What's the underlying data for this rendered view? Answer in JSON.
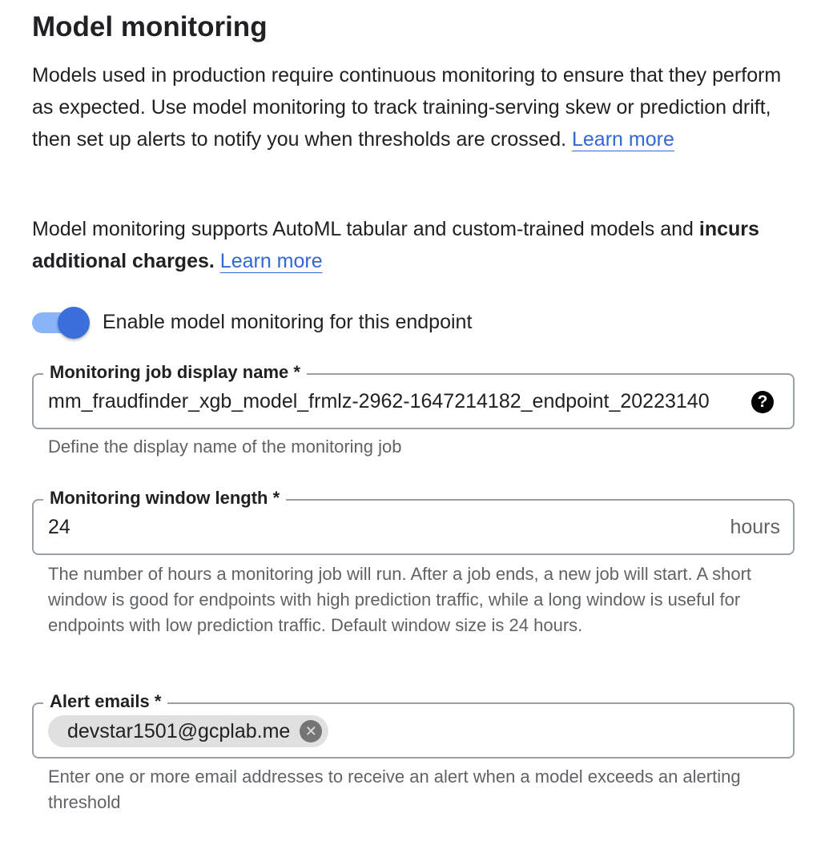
{
  "header": {
    "title": "Model monitoring"
  },
  "intro": {
    "text": "Models used in production require continuous monitoring to ensure that they perform as expected. Use model monitoring to track training-serving skew or prediction drift, then set up alerts to notify you when thresholds are crossed.",
    "link": "Learn more"
  },
  "support": {
    "text_before": "Model monitoring supports AutoML tabular and custom-trained models and ",
    "bold": "incurs additional charges.",
    "link": "Learn more"
  },
  "toggle": {
    "label": "Enable model monitoring for this endpoint",
    "enabled": true
  },
  "job_name": {
    "label": "Monitoring job display name *",
    "value": "mm_fraudfinder_xgb_model_frmlz-2962-1647214182_endpoint_20223140",
    "helper": "Define the display name of the monitoring job",
    "help_icon": "help-circle-icon"
  },
  "window_length": {
    "label": "Monitoring window length *",
    "value": "24",
    "suffix": "hours",
    "helper": "The number of hours a monitoring job will run. After a job ends, a new job will start. A short window is good for endpoints with high prediction traffic, while a long window is useful for endpoints with low prediction traffic. Default window size is 24 hours."
  },
  "alert_emails": {
    "label": "Alert emails *",
    "chips": [
      "devstar1501@gcplab.me"
    ],
    "remove_icon": "close-circle-icon",
    "helper": "Enter one or more email addresses to receive an alert when a model exceeds an alerting threshold"
  },
  "colors": {
    "link": "#3367d6",
    "toggle_thumb": "#3b6fdb",
    "toggle_track": "#8ab4f8",
    "border": "#9aa0a6",
    "helper_text": "#5f6368",
    "chip_bg": "#e0e0e0"
  }
}
